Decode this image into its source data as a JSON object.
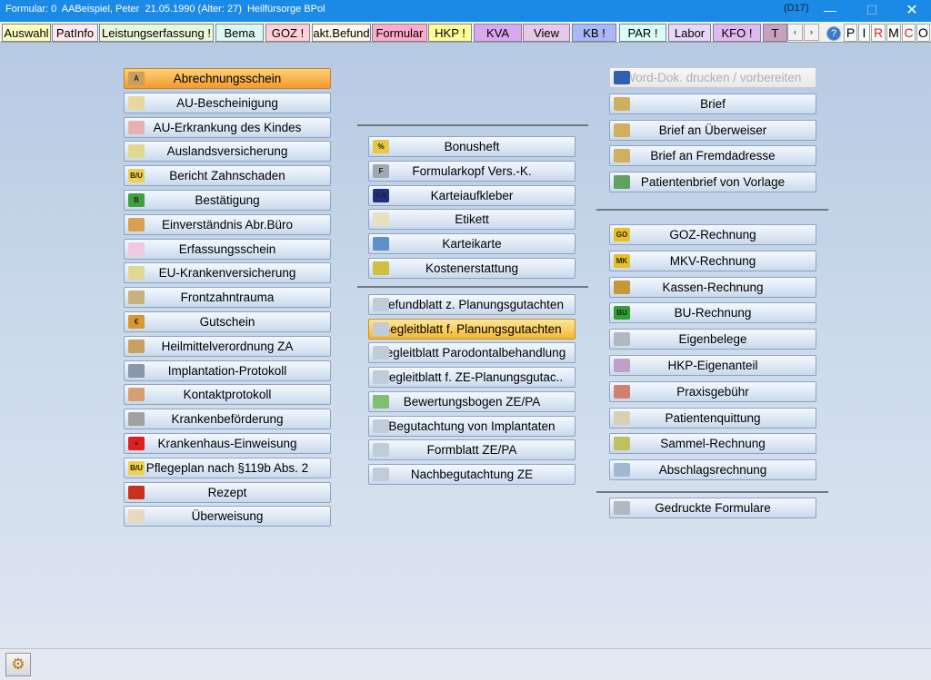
{
  "window": {
    "title": "Formular: 0  AABeispiel, Peter  21.05.1990 (Alter: 27)  Heilfürsorge BPol",
    "code": "(D17)",
    "minimize_icon": "minimize-icon",
    "maximize_icon": "maximize-icon",
    "close_icon": "close-icon"
  },
  "tabs": [
    {
      "label": "Auswahl",
      "color": "#ffffc0"
    },
    {
      "label": "PatInfo",
      "color": "#ffe8ee"
    },
    {
      "label": "Leistungserfassung !",
      "color": "#e8f8d8"
    },
    {
      "label": "Bema",
      "color": "#d8f8f0"
    },
    {
      "label": "GOZ !",
      "color": "#ffd0d8"
    },
    {
      "label": "akt.Befund",
      "color": "#fff8e8"
    },
    {
      "label": "Formular",
      "color": "#ffaacc"
    },
    {
      "label": "HKP !",
      "color": "#ffff98"
    },
    {
      "label": "KVA",
      "color": "#d8a8f0"
    },
    {
      "label": "View",
      "color": "#e8c8e8"
    },
    {
      "label": "KB !",
      "color": "#a8b8f8"
    },
    {
      "label": "PAR !",
      "color": "#d8fff8"
    },
    {
      "label": "Labor",
      "color": "#e8d8f8"
    },
    {
      "label": "KFO !",
      "color": "#e0b8f0"
    },
    {
      "label": "T",
      "color": "#c8a0c0"
    }
  ],
  "tab_nav": {
    "prev": "‹",
    "next": "›"
  },
  "toolbar_icons": [
    {
      "label": "?",
      "name": "help-icon",
      "color": "#2060c0"
    },
    {
      "label": "P",
      "name": "p-button",
      "color": "#000000"
    },
    {
      "label": "I",
      "name": "i-button",
      "color": "#000000"
    },
    {
      "label": "R",
      "name": "r-button",
      "color": "#e02020"
    },
    {
      "label": "M",
      "name": "m-button",
      "color": "#000000"
    },
    {
      "label": "C",
      "name": "c-button",
      "color": "#e02020"
    },
    {
      "label": "O",
      "name": "o-button",
      "color": "#000000"
    }
  ],
  "column1": [
    {
      "label": "Abrechnungsschein",
      "icon": "form-icon",
      "state": "highlight"
    },
    {
      "label": "AU-Bescheinigung",
      "icon": "document-icon"
    },
    {
      "label": "AU-Erkrankung des Kindes",
      "icon": "child-icon"
    },
    {
      "label": "Auslandsversicherung",
      "icon": "plane-icon"
    },
    {
      "label": "Bericht Zahnschaden",
      "icon": "bu-icon"
    },
    {
      "label": "Bestätigung",
      "icon": "green-b-icon"
    },
    {
      "label": "Einverständnis Abr.Büro",
      "icon": "handshake-icon"
    },
    {
      "label": "Erfassungsschein",
      "icon": "pink-form-icon"
    },
    {
      "label": "EU-Krankenversicherung",
      "icon": "plane-icon"
    },
    {
      "label": "Frontzahntrauma",
      "icon": "tooth-icon"
    },
    {
      "label": "Gutschein",
      "icon": "euro-icon"
    },
    {
      "label": "Heilmittelverordnung ZA",
      "icon": "book-icon"
    },
    {
      "label": "Implantation-Protokoll",
      "icon": "implant-icon"
    },
    {
      "label": "Kontaktprotokoll",
      "icon": "teeth-icon"
    },
    {
      "label": "Krankenbeförderung",
      "icon": "car-icon"
    },
    {
      "label": "Krankenhaus-Einweisung",
      "icon": "red-cross-icon"
    },
    {
      "label": "Pflegeplan nach §119b Abs. 2",
      "icon": "bu-icon"
    },
    {
      "label": "Rezept",
      "icon": "prescription-icon"
    },
    {
      "label": "Überweisung",
      "icon": "transfer-icon"
    }
  ],
  "column2_top": [
    {
      "label": "Bonusheft",
      "icon": "percent-icon"
    },
    {
      "label": "Formularkopf Vers.-K.",
      "icon": "form-header-icon"
    },
    {
      "label": "Karteiaufkleber",
      "icon": "ka-icon"
    },
    {
      "label": "Etikett",
      "icon": "label-icon"
    },
    {
      "label": "Karteikarte",
      "icon": "index-card-icon"
    },
    {
      "label": "Kostenerstattung",
      "icon": "refund-icon"
    }
  ],
  "column2_bottom": [
    {
      "label": "Befundblatt z. Planungsgutachten",
      "icon": "sheet-icon"
    },
    {
      "label": "Begleitblatt f. Planungsgutachten",
      "icon": "sheet-icon",
      "state": "highlight2"
    },
    {
      "label": "Begleitblatt Parodontalbehandlung",
      "icon": "sheet-icon"
    },
    {
      "label": "Begleitblatt f. ZE-Planungsgutac..",
      "icon": "sheet-icon"
    },
    {
      "label": "Bewertungsbogen ZE/PA",
      "icon": "sheet-green-icon"
    },
    {
      "label": "Begutachtung von Implantaten",
      "icon": "sheet-icon"
    },
    {
      "label": "Formblatt ZE/PA",
      "icon": "sheet-icon"
    },
    {
      "label": "Nachbegutachtung ZE",
      "icon": "sheet-icon"
    }
  ],
  "column3_top": [
    {
      "label": "Word-Dok. drucken / vorbereiten",
      "icon": "word-icon",
      "state": "disabled"
    },
    {
      "label": "Brief",
      "icon": "person-icon"
    },
    {
      "label": "Brief an Überweiser",
      "icon": "persons-icon"
    },
    {
      "label": "Brief an Fremdadresse",
      "icon": "persons-icon"
    },
    {
      "label": "Patientenbrief von Vorlage",
      "icon": "person-letter-icon"
    }
  ],
  "column3_middle": [
    {
      "label": "GOZ-Rechnung",
      "icon": "goz-icon"
    },
    {
      "label": "MKV-Rechnung",
      "icon": "mkv-icon"
    },
    {
      "label": "Kassen-Rechnung",
      "icon": "money-icon"
    },
    {
      "label": "BU-Rechnung",
      "icon": "bu-green-icon"
    },
    {
      "label": "Eigenbelege",
      "icon": "printer-icon"
    },
    {
      "label": "HKP-Eigenanteil",
      "icon": "person-card-icon"
    },
    {
      "label": "Praxisgebühr",
      "icon": "cash-icon"
    },
    {
      "label": "Patientenquittung",
      "icon": "receipt-icon"
    },
    {
      "label": "Sammel-Rechnung",
      "icon": "funnel-icon"
    },
    {
      "label": "Abschlagsrechnung",
      "icon": "invoice-icon"
    }
  ],
  "column3_bottom": [
    {
      "label": "Gedruckte Formulare",
      "icon": "printer-icon"
    }
  ],
  "statusbar": {
    "gear_icon": "gear-icon"
  }
}
